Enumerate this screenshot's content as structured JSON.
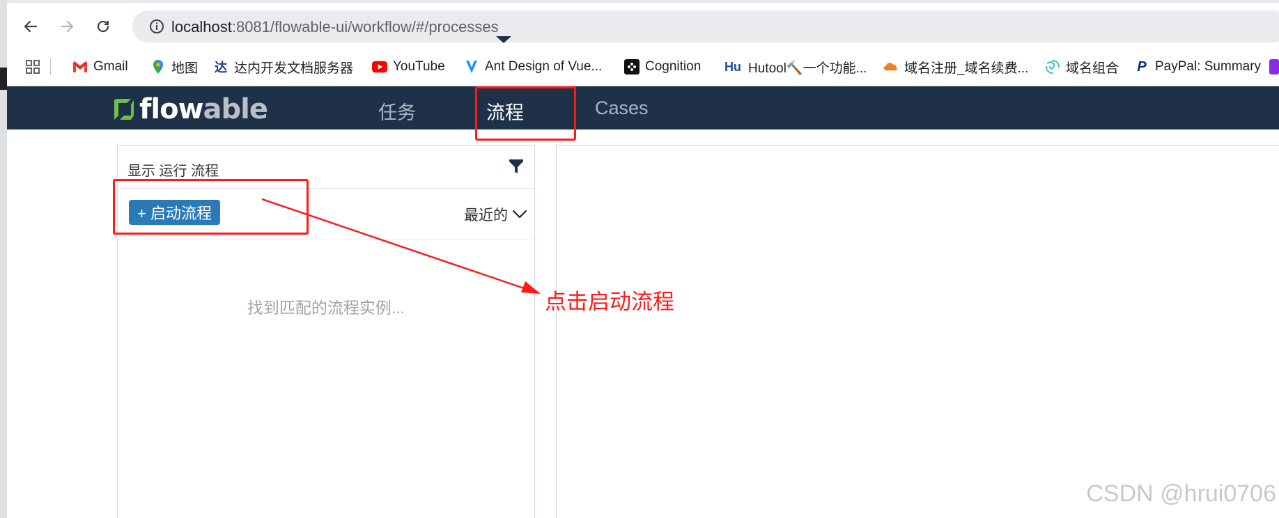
{
  "browser": {
    "url_host": "localhost",
    "url_path": ":8081/flowable-ui/workflow/#/processes",
    "bookmarks": [
      {
        "label": "Gmail",
        "icon": "gmail-icon"
      },
      {
        "label": "地图",
        "icon": "maps-pin-icon"
      },
      {
        "label": "达内开发文档服务器",
        "icon": "tarena-icon"
      },
      {
        "label": "YouTube",
        "icon": "youtube-icon"
      },
      {
        "label": "Ant Design of Vue...",
        "icon": "antdv-icon"
      },
      {
        "label": "Cognition",
        "icon": "cognition-icon"
      },
      {
        "label": "Hutool🔨一个功能...",
        "icon": "hutool-icon"
      },
      {
        "label": "域名注册_域名续费...",
        "icon": "cloud-icon"
      },
      {
        "label": "域名组合",
        "icon": "swirl-icon"
      },
      {
        "label": "PayPal: Summary",
        "icon": "paypal-icon"
      }
    ],
    "colors": {
      "omnibox": "#e9ebee"
    }
  },
  "app": {
    "logo_text_a": "flow",
    "logo_text_b": "able",
    "nav": {
      "tab_tasks": "任务",
      "tab_processes": "流程",
      "tab_cases": "Cases"
    },
    "colors": {
      "navbar": "#1e3148",
      "primary_button": "#2a7ab8",
      "logo_green": "#6dbe4a"
    }
  },
  "process_list": {
    "title": "显示 运行 流程",
    "start_button": "+ 启动流程",
    "sort_label": "最近的",
    "empty_message": "找到匹配的流程实例..."
  },
  "annotation": {
    "text": "点击启动流程",
    "color": "#ff1a1a"
  },
  "watermark": "CSDN @hrui0706"
}
